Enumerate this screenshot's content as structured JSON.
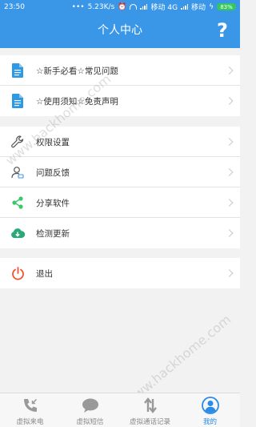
{
  "status_bar": {
    "time": "23:50",
    "network_speed": "5.23K/s",
    "carrier_1": "移动 4G",
    "carrier_2": "移动",
    "battery": "83%"
  },
  "header": {
    "title": "个人中心",
    "help_glyph": "?"
  },
  "menu_group_1": [
    {
      "label": "☆新手必看☆常见问题",
      "icon": "document-icon"
    },
    {
      "label": "☆使用须知☆免责声明",
      "icon": "document-icon"
    }
  ],
  "menu_group_2": [
    {
      "label": "权限设置",
      "icon": "wrench-icon"
    },
    {
      "label": "问题反馈",
      "icon": "user-feedback-icon"
    },
    {
      "label": "分享软件",
      "icon": "share-icon"
    },
    {
      "label": "检测更新",
      "icon": "cloud-download-icon"
    }
  ],
  "menu_group_3": [
    {
      "label": "退出",
      "icon": "power-icon"
    }
  ],
  "tabbar": [
    {
      "label": "虚拟来电",
      "icon": "phone-incoming-icon",
      "active": false
    },
    {
      "label": "虚拟短信",
      "icon": "chat-bubble-icon",
      "active": false
    },
    {
      "label": "虚拟通话记录",
      "icon": "transfer-arrows-icon",
      "active": false
    },
    {
      "label": "我的",
      "icon": "profile-icon",
      "active": true
    }
  ],
  "watermark": "www.hackhome.com",
  "colors": {
    "primary": "#3a97e8",
    "doc_icon": "#2e9ae6",
    "share_icon": "#3cc66a",
    "update_icon": "#2aa876",
    "exit_icon": "#f0532d",
    "tab_active": "#2b8be6"
  }
}
